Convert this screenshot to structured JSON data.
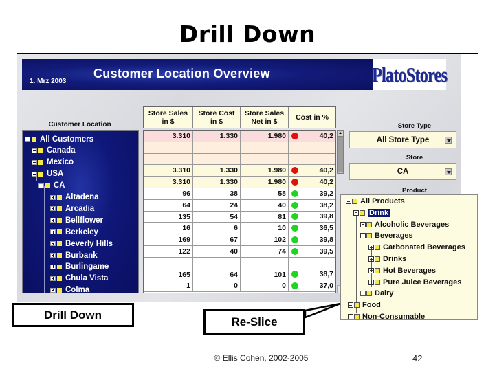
{
  "slide": {
    "title": "Drill Down",
    "footer_copyright": "© Ellis Cohen, 2002-2005",
    "page_number": "42"
  },
  "app": {
    "date": "1. Mrz 2003",
    "title": "Customer Location Overview",
    "logo": "PlatoStores"
  },
  "customer_tree": {
    "label": "Customer Location",
    "items": [
      {
        "label": "All Customers",
        "level": 0,
        "toggle": "collapse"
      },
      {
        "label": "Canada",
        "level": 1,
        "toggle": "collapse"
      },
      {
        "label": "Mexico",
        "level": 1,
        "toggle": "collapse"
      },
      {
        "label": "USA",
        "level": 1,
        "toggle": "collapse"
      },
      {
        "label": "CA",
        "level": 2,
        "toggle": "collapse"
      },
      {
        "label": "Altadena",
        "level": 3,
        "toggle": "expand"
      },
      {
        "label": "Arcadia",
        "level": 3,
        "toggle": "expand"
      },
      {
        "label": "Bellflower",
        "level": 3,
        "toggle": "expand"
      },
      {
        "label": "Berkeley",
        "level": 3,
        "toggle": "expand"
      },
      {
        "label": "Beverly Hills",
        "level": 3,
        "toggle": "expand"
      },
      {
        "label": "Burbank",
        "level": 3,
        "toggle": "expand"
      },
      {
        "label": "Burlingame",
        "level": 3,
        "toggle": "expand"
      },
      {
        "label": "Chula Vista",
        "level": 3,
        "toggle": "expand"
      },
      {
        "label": "Colma",
        "level": 3,
        "toggle": "expand"
      }
    ]
  },
  "grid": {
    "headers": [
      "Store Sales in $",
      "Store Cost in $",
      "Store Sales Net in $",
      "Cost in %"
    ],
    "header_lines": [
      [
        "Store Sales",
        "in $"
      ],
      [
        "Store Cost",
        "in $"
      ],
      [
        "Store Sales",
        "Net in $"
      ],
      [
        "Cost in %",
        ""
      ]
    ],
    "rows": [
      {
        "sales": "3.310",
        "cost": "1.330",
        "net": "1.980",
        "status": "red",
        "pct": "40,2",
        "bg": "pink"
      },
      {
        "sales": "",
        "cost": "",
        "net": "",
        "status": "",
        "pct": "",
        "bg": "peach"
      },
      {
        "sales": "",
        "cost": "",
        "net": "",
        "status": "",
        "pct": "",
        "bg": "peach"
      },
      {
        "sales": "3.310",
        "cost": "1.330",
        "net": "1.980",
        "status": "red",
        "pct": "40,2",
        "bg": "cream"
      },
      {
        "sales": "3.310",
        "cost": "1.330",
        "net": "1.980",
        "status": "red",
        "pct": "40,2",
        "bg": "cream"
      },
      {
        "sales": "96",
        "cost": "38",
        "net": "58",
        "status": "green",
        "pct": "39,2",
        "bg": "white"
      },
      {
        "sales": "64",
        "cost": "24",
        "net": "40",
        "status": "green",
        "pct": "38,2",
        "bg": "white"
      },
      {
        "sales": "135",
        "cost": "54",
        "net": "81",
        "status": "green",
        "pct": "39,8",
        "bg": "white"
      },
      {
        "sales": "16",
        "cost": "6",
        "net": "10",
        "status": "green",
        "pct": "36,5",
        "bg": "white"
      },
      {
        "sales": "169",
        "cost": "67",
        "net": "102",
        "status": "green",
        "pct": "39,8",
        "bg": "white"
      },
      {
        "sales": "122",
        "cost": "40",
        "net": "74",
        "status": "green",
        "pct": "39,5",
        "bg": "white"
      },
      {
        "sales": "",
        "cost": "",
        "net": "",
        "status": "",
        "pct": "",
        "bg": "white"
      },
      {
        "sales": "165",
        "cost": "64",
        "net": "101",
        "status": "green",
        "pct": "38,7",
        "bg": "white"
      },
      {
        "sales": "1",
        "cost": "0",
        "net": "0",
        "status": "green",
        "pct": "37,0",
        "bg": "white"
      }
    ]
  },
  "filters": {
    "store_type_label": "Store Type",
    "store_type_value": "All Store Type",
    "store_label": "Store",
    "store_value": "CA",
    "product_label": "Product"
  },
  "product_tree": {
    "items": [
      {
        "label": "All Products",
        "level": 0,
        "toggle": "collapse",
        "selected": false
      },
      {
        "label": "Drink",
        "level": 1,
        "toggle": "collapse",
        "selected": true
      },
      {
        "label": "Alcoholic Beverages",
        "level": 2,
        "toggle": "collapse",
        "selected": false
      },
      {
        "label": "Beverages",
        "level": 2,
        "toggle": "collapse",
        "selected": false
      },
      {
        "label": "Carbonated Beverages",
        "level": 3,
        "toggle": "expand",
        "selected": false
      },
      {
        "label": "Drinks",
        "level": 3,
        "toggle": "expand",
        "selected": false
      },
      {
        "label": "Hot Beverages",
        "level": 3,
        "toggle": "expand",
        "selected": false
      },
      {
        "label": "Pure Juice Beverages",
        "level": 3,
        "toggle": "expand",
        "selected": false
      },
      {
        "label": "Dairy",
        "level": 2,
        "toggle": "leaf",
        "selected": false
      },
      {
        "label": "Food",
        "level": 1,
        "toggle": "expand",
        "selected": false
      },
      {
        "label": "Non-Consumable",
        "level": 1,
        "toggle": "expand",
        "selected": false
      }
    ]
  },
  "callouts": {
    "drill_down": "Drill Down",
    "reslice": "Re-Slice"
  },
  "colors": {
    "banner_blue": "#121b7a",
    "status_red": "#e01010",
    "status_green": "#22d422",
    "cream": "#fdf9dd",
    "selection": "#0a1670"
  }
}
